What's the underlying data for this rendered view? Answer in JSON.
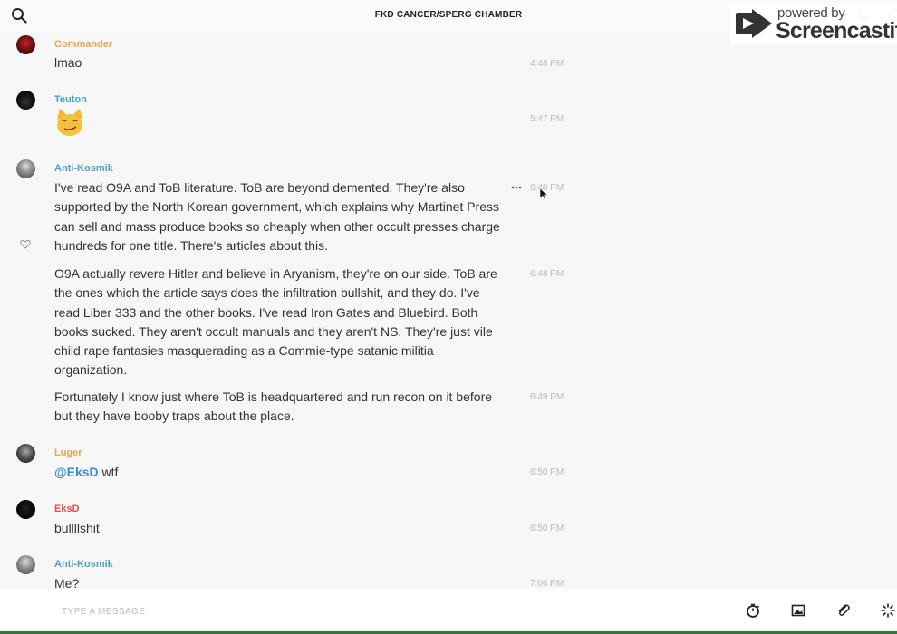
{
  "header": {
    "channel_title": "FKD CANCER/SPERG CHAMBER",
    "search_icon": "search-icon",
    "phone_icon": "phone-icon",
    "info_icon": "info-icon"
  },
  "watermark": {
    "powered_by": "powered by",
    "brand": "Screencastify"
  },
  "messages": [
    {
      "user": "Commander",
      "user_color": "#f0a050",
      "text": "lmao",
      "time": "4:48 PM"
    },
    {
      "user": "Teuton",
      "user_color": "#4aa0d0",
      "emoji": "smirking-cat-face",
      "time": "5:47 PM"
    },
    {
      "user": "Anti-Kosmik",
      "user_color": "#4aa0d0",
      "text": "I've read O9A and ToB literature. ToB are beyond demented. They're also supported by the North Korean government, which explains why Martinet Press can sell and mass produce books so cheaply when other occult presses charge hundreds for one title. There's articles about this.",
      "time": "6:48 PM"
    },
    {
      "text": "O9A actually revere Hitler and believe in Aryanism, they're on our side. ToB are the ones which the article says does the infiltration bullshit, and they do. I've read Liber 333 and the other books. I've read Iron Gates and Bluebird. Both books sucked. They aren't occult manuals and they aren't NS. They're just vile child rape fantasies masquerading as a Commie-type satanic militia organization.",
      "time": "6:48 PM"
    },
    {
      "text": "Fortunately I know just where ToB is headquartered and run recon on it before but they have booby traps about the place.",
      "time": "6:49 PM"
    },
    {
      "user": "Luger",
      "user_color": "#f0a050",
      "mention": "@EksD",
      "text": " wtf",
      "time": "6:50 PM"
    },
    {
      "user": "EksD",
      "user_color": "#e05050",
      "text": "bullllshit",
      "time": "6:50 PM"
    },
    {
      "user": "Anti-Kosmik",
      "user_color": "#4aa0d0",
      "text": "Me?",
      "time": "7:06 PM"
    }
  ],
  "composer": {
    "placeholder": "TYPE A MESSAGE",
    "tools": [
      "timer-icon",
      "image-icon",
      "attachment-icon",
      "loading-icon"
    ]
  }
}
